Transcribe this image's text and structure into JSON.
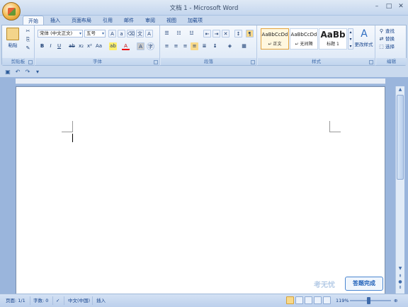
{
  "window": {
    "title": "文档 1 - Microsoft Word",
    "min": "–",
    "max": "□",
    "close": "✕"
  },
  "tabs": [
    "开始",
    "插入",
    "页面布局",
    "引用",
    "邮件",
    "审阅",
    "视图",
    "加载项"
  ],
  "clipboard": {
    "paste": "粘贴",
    "group": "剪贴板"
  },
  "font": {
    "name": "宋体 (中文正文)",
    "size": "五号",
    "group": "字体",
    "icons": [
      "grow-font",
      "shrink-font",
      "clear-format",
      "phonetic",
      "border-char",
      "bold",
      "italic",
      "underline",
      "strikethrough",
      "subscript",
      "superscript",
      "change-case",
      "highlight",
      "font-color",
      "char-shading",
      "enclose-char"
    ]
  },
  "paragraph": {
    "group": "段落"
  },
  "styles": {
    "group": "样式",
    "items": [
      {
        "sample": "AaBbCcDd",
        "name": "↵ 正文"
      },
      {
        "sample": "AaBbCcDd",
        "name": "↵ 无间隔"
      },
      {
        "sample": "AaBb",
        "name": "标题 1"
      }
    ],
    "change": "更改样式"
  },
  "editing": {
    "group": "编辑",
    "find": "查找",
    "replace": "替换",
    "select": "选择"
  },
  "status": {
    "page": "页面: 1/1",
    "words": "字数: 0",
    "lang": "中文(中国)",
    "mode": "插入",
    "zoom": "119%"
  },
  "overlay": {
    "done": "答题完成",
    "watermark": "考无忧"
  },
  "colors": {
    "accent": "#15428b",
    "ribbon": "#dbe7f6",
    "doc_bg": "#9ab5dc",
    "active_tab": "#f6f9fd"
  }
}
